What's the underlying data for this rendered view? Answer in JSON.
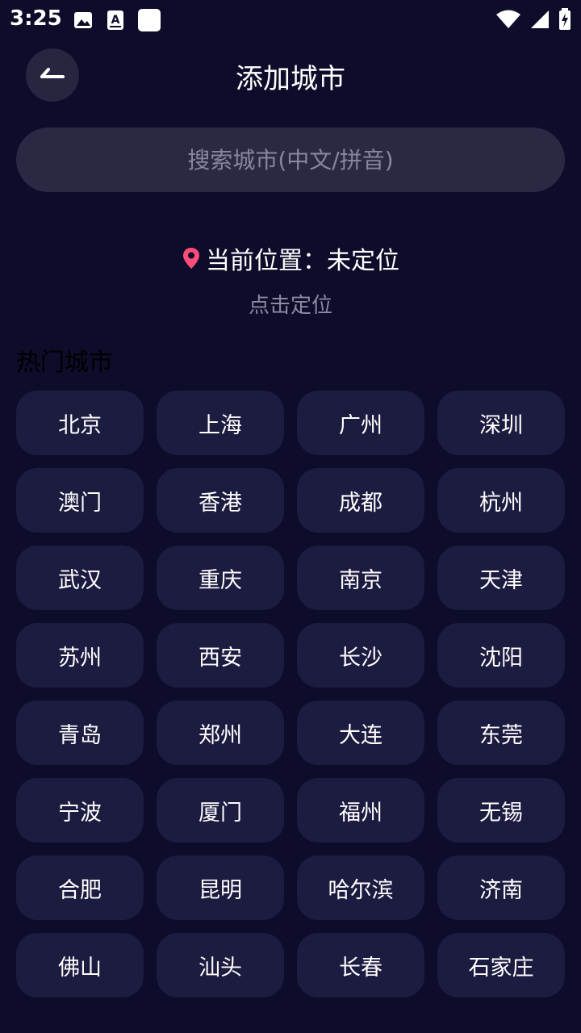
{
  "status_bar": {
    "time": "3:25",
    "icons": [
      "image-icon",
      "a-keyboard-icon",
      "square-icon",
      "wifi-icon",
      "signal-icon",
      "battery-charging-icon"
    ]
  },
  "header": {
    "back_icon": "arrow-left-icon",
    "title": "添加城市"
  },
  "search": {
    "placeholder": "搜索城市(中文/拼音)",
    "value": ""
  },
  "location": {
    "icon": "location-pin-icon",
    "icon_color": "#ff4d7a",
    "text": "当前位置：未定位",
    "action": "点击定位"
  },
  "hot_cities": {
    "title": "热门城市",
    "cities": [
      "北京",
      "上海",
      "广州",
      "深圳",
      "澳门",
      "香港",
      "成都",
      "杭州",
      "武汉",
      "重庆",
      "南京",
      "天津",
      "苏州",
      "西安",
      "长沙",
      "沈阳",
      "青岛",
      "郑州",
      "大连",
      "东莞",
      "宁波",
      "厦门",
      "福州",
      "无锡",
      "合肥",
      "昆明",
      "哈尔滨",
      "济南",
      "佛山",
      "汕头",
      "长春",
      "石家庄"
    ]
  },
  "colors": {
    "background": "#0d0c2a",
    "city_button": "#1c1b40",
    "search_bg": "#2a2944",
    "back_button_bg": "#262640"
  }
}
